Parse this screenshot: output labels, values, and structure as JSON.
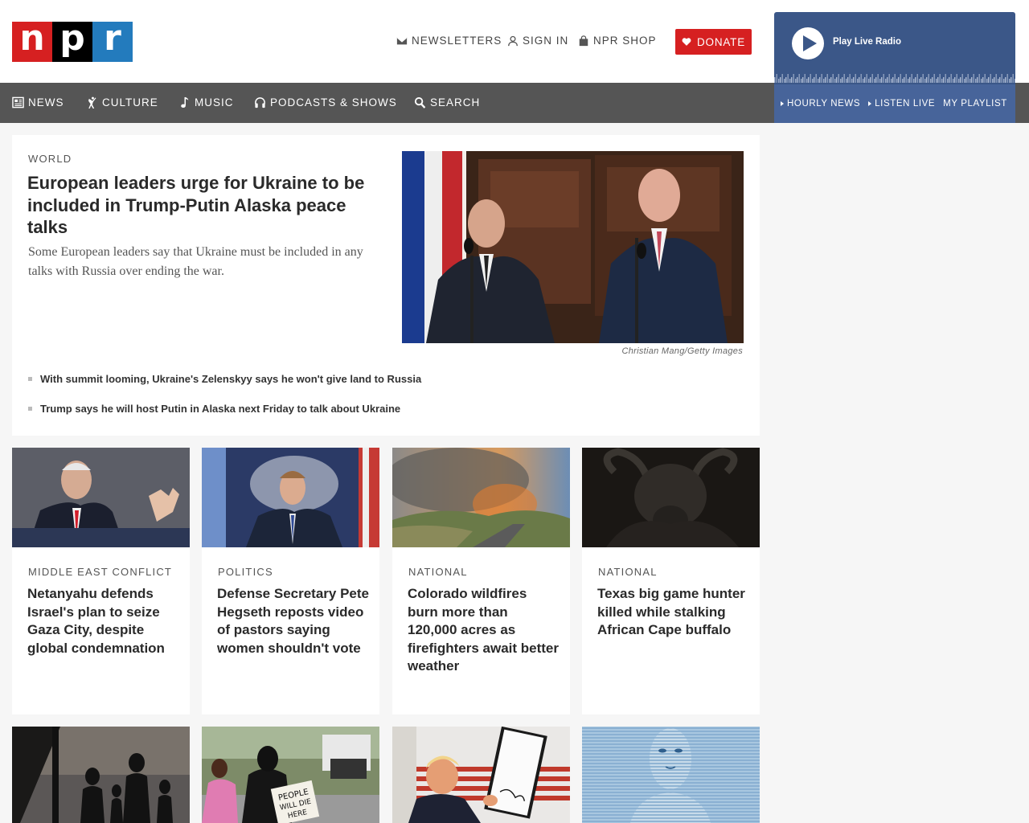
{
  "logo": {
    "letters": [
      "n",
      "p",
      "r"
    ]
  },
  "header": {
    "newsletters": "NEWSLETTERS",
    "sign_in": "SIGN IN",
    "shop": "NPR SHOP",
    "donate": "DONATE"
  },
  "nav": {
    "items": [
      {
        "label": "NEWS",
        "icon": "newspaper-icon"
      },
      {
        "label": "CULTURE",
        "icon": "dancer-icon"
      },
      {
        "label": "MUSIC",
        "icon": "music-note-icon"
      },
      {
        "label": "PODCASTS & SHOWS",
        "icon": "headphones-icon"
      },
      {
        "label": "SEARCH",
        "icon": "search-icon"
      }
    ]
  },
  "player": {
    "label": "Play Live Radio",
    "links": [
      "HOURLY NEWS",
      "LISTEN LIVE",
      "MY PLAYLIST"
    ]
  },
  "featured": {
    "slug": "WORLD",
    "headline": "European leaders urge for Ukraine to be included in Trump-Putin Alaska peace talks",
    "teaser": "Some European leaders say that Ukraine must be included in any talks with Russia over ending the war.",
    "credit": "Christian Mang/Getty Images",
    "related": [
      "With summit looming, Ukraine's Zelenskyy says he won't give land to Russia",
      "Trump says he will host Putin in Alaska next Friday to talk about Ukraine"
    ]
  },
  "stories": [
    {
      "slug": "MIDDLE EAST CONFLICT",
      "title": "Netanyahu defends Israel's plan to seize Gaza City, despite global condemnation"
    },
    {
      "slug": "POLITICS",
      "title": "Defense Secretary Pete Hegseth reposts video of pastors saying women shouldn't vote"
    },
    {
      "slug": "NATIONAL",
      "title": "Colorado wildfires burn more than 120,000 acres as firefighters await better weather"
    },
    {
      "slug": "NATIONAL",
      "title": "Texas big game hunter killed while stalking African Cape buffalo"
    }
  ],
  "sign_text": "PEOPLE WILL DIE HERE",
  "colors": {
    "brand_red": "#d62021",
    "brand_blue": "#237bbd",
    "nav_gray": "#555555",
    "player_blue": "#3b5788"
  }
}
